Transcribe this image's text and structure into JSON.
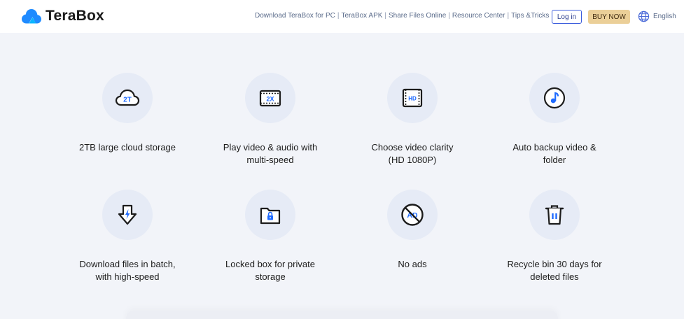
{
  "header": {
    "brand": "TeraBox",
    "nav": [
      {
        "label": "Download TeraBox for PC"
      },
      {
        "label": "TeraBox APK"
      },
      {
        "label": "Share Files Online"
      },
      {
        "label": "Resource Center"
      },
      {
        "label": "Tips &Tricks"
      }
    ],
    "nav_separator": "|",
    "login_label": "Log in",
    "buy_label": "BUY NOW",
    "language": "English"
  },
  "features": [
    {
      "icon": "cloud-2t-icon",
      "icon_text": "2T",
      "lines": [
        "2TB large cloud storage",
        ""
      ]
    },
    {
      "icon": "video-2x-icon",
      "icon_text": "2X",
      "lines": [
        "Play video & audio with",
        "multi-speed"
      ]
    },
    {
      "icon": "video-hd-icon",
      "icon_text": "HD",
      "lines": [
        "Choose video clarity",
        "(HD 1080P)"
      ]
    },
    {
      "icon": "music-note-icon",
      "icon_text": "",
      "lines": [
        "Auto backup video &",
        "folder"
      ]
    },
    {
      "icon": "download-arrow-icon",
      "icon_text": "",
      "lines": [
        "Download files in batch,",
        "with high-speed"
      ]
    },
    {
      "icon": "locked-folder-icon",
      "icon_text": "",
      "lines": [
        "Locked box for private",
        "storage"
      ]
    },
    {
      "icon": "no-ads-icon",
      "icon_text": "AD",
      "lines": [
        "No ads",
        ""
      ]
    },
    {
      "icon": "trash-bin-icon",
      "icon_text": "",
      "lines": [
        "Recycle bin 30 days for",
        "deleted files"
      ]
    }
  ],
  "colors": {
    "brand_blue": "#1f6bff",
    "icon_dark": "#1c1c1c",
    "circle_bg": "#e6ebf6",
    "page_bg": "#f2f4f9",
    "buy_button": "#ebcf98",
    "login_border": "#3a5cdc"
  }
}
